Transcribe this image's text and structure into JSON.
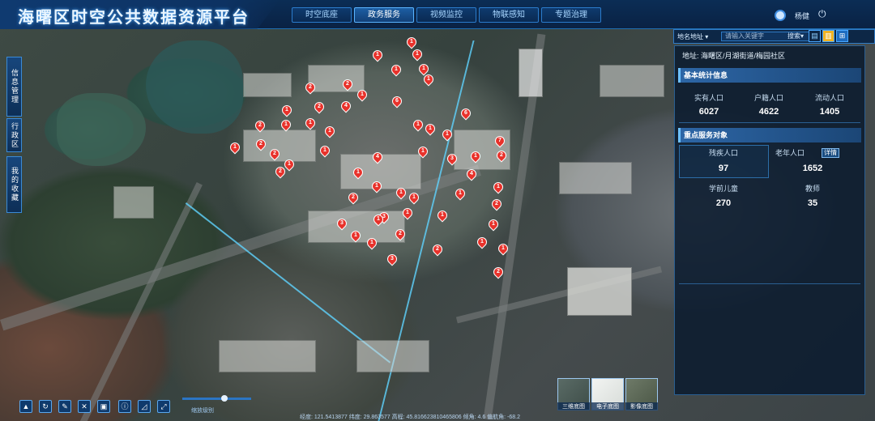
{
  "app": {
    "title": "海曙区时空公共数据资源平台"
  },
  "nav": {
    "items": [
      {
        "label": "时空底座"
      },
      {
        "label": "政务服务"
      },
      {
        "label": "视频监控"
      },
      {
        "label": "物联感知"
      },
      {
        "label": "专题治理"
      }
    ]
  },
  "user": {
    "name": "杨健"
  },
  "search": {
    "select_label": "地名地址",
    "placeholder": "请输入关键字",
    "button_label": "搜索"
  },
  "side_tabs": [
    {
      "label": "信息管理"
    },
    {
      "label": "行政区"
    },
    {
      "label": "我的收藏"
    }
  ],
  "panel": {
    "address": "地址: 海曙区/月湖街道/梅园社区",
    "basic_title": "基本统计信息",
    "basic": [
      {
        "label": "实有人口",
        "value": "6027"
      },
      {
        "label": "户籍人口",
        "value": "4622"
      },
      {
        "label": "流动人口",
        "value": "1405"
      }
    ],
    "service_title": "重点服务对象",
    "services": [
      {
        "label": "残疾人口",
        "value": "97"
      },
      {
        "label": "老年人口",
        "value": "1652"
      },
      {
        "label": "学前儿童",
        "value": "270"
      },
      {
        "label": "教师",
        "value": "35"
      }
    ],
    "detail_label": "详情"
  },
  "pins": [
    "1",
    "1",
    "1",
    "1",
    "1",
    "1",
    "2",
    "2",
    "1",
    "2",
    "4",
    "6",
    "1",
    "2",
    "1",
    "1",
    "1",
    "1",
    "6",
    "2",
    "1",
    "2",
    "1",
    "1",
    "1",
    "1",
    "1",
    "1",
    "7",
    "1",
    "4",
    "1",
    "3",
    "2",
    "1",
    "1",
    "1",
    "2",
    "3",
    "2",
    "1",
    "1",
    "1",
    "1",
    "1",
    "3",
    "2",
    "1",
    "4",
    "2",
    "1",
    "3",
    "2",
    "1",
    "1",
    "2"
  ],
  "toolbar": {
    "zoom_label": "缩放级别"
  },
  "status": {
    "coords": "经度: 121.5413877  纬度: 29.863577  高程: 45.816623810465806  倾角: 4.6  偏航角: -68.2"
  },
  "thumbs": [
    {
      "label": "三维底图"
    },
    {
      "label": "电子底图"
    },
    {
      "label": "影像底图"
    }
  ]
}
